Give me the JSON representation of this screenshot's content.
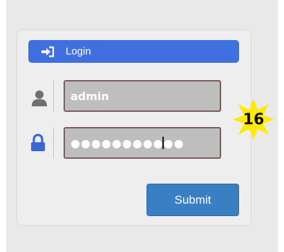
{
  "login": {
    "header_label": "Login",
    "header_icon": "sign-in-icon",
    "username": {
      "icon": "user-icon",
      "value": "admin"
    },
    "password": {
      "icon": "lock-icon",
      "value": "●●●●●●●●●●●"
    },
    "submit_label": "Submit"
  },
  "badge": {
    "text": "16",
    "color": "#ffea00"
  },
  "colors": {
    "header": "#4070e0",
    "submit": "#3a7fc2",
    "field_bg": "#bebebe",
    "field_border": "#7b5b5b"
  }
}
